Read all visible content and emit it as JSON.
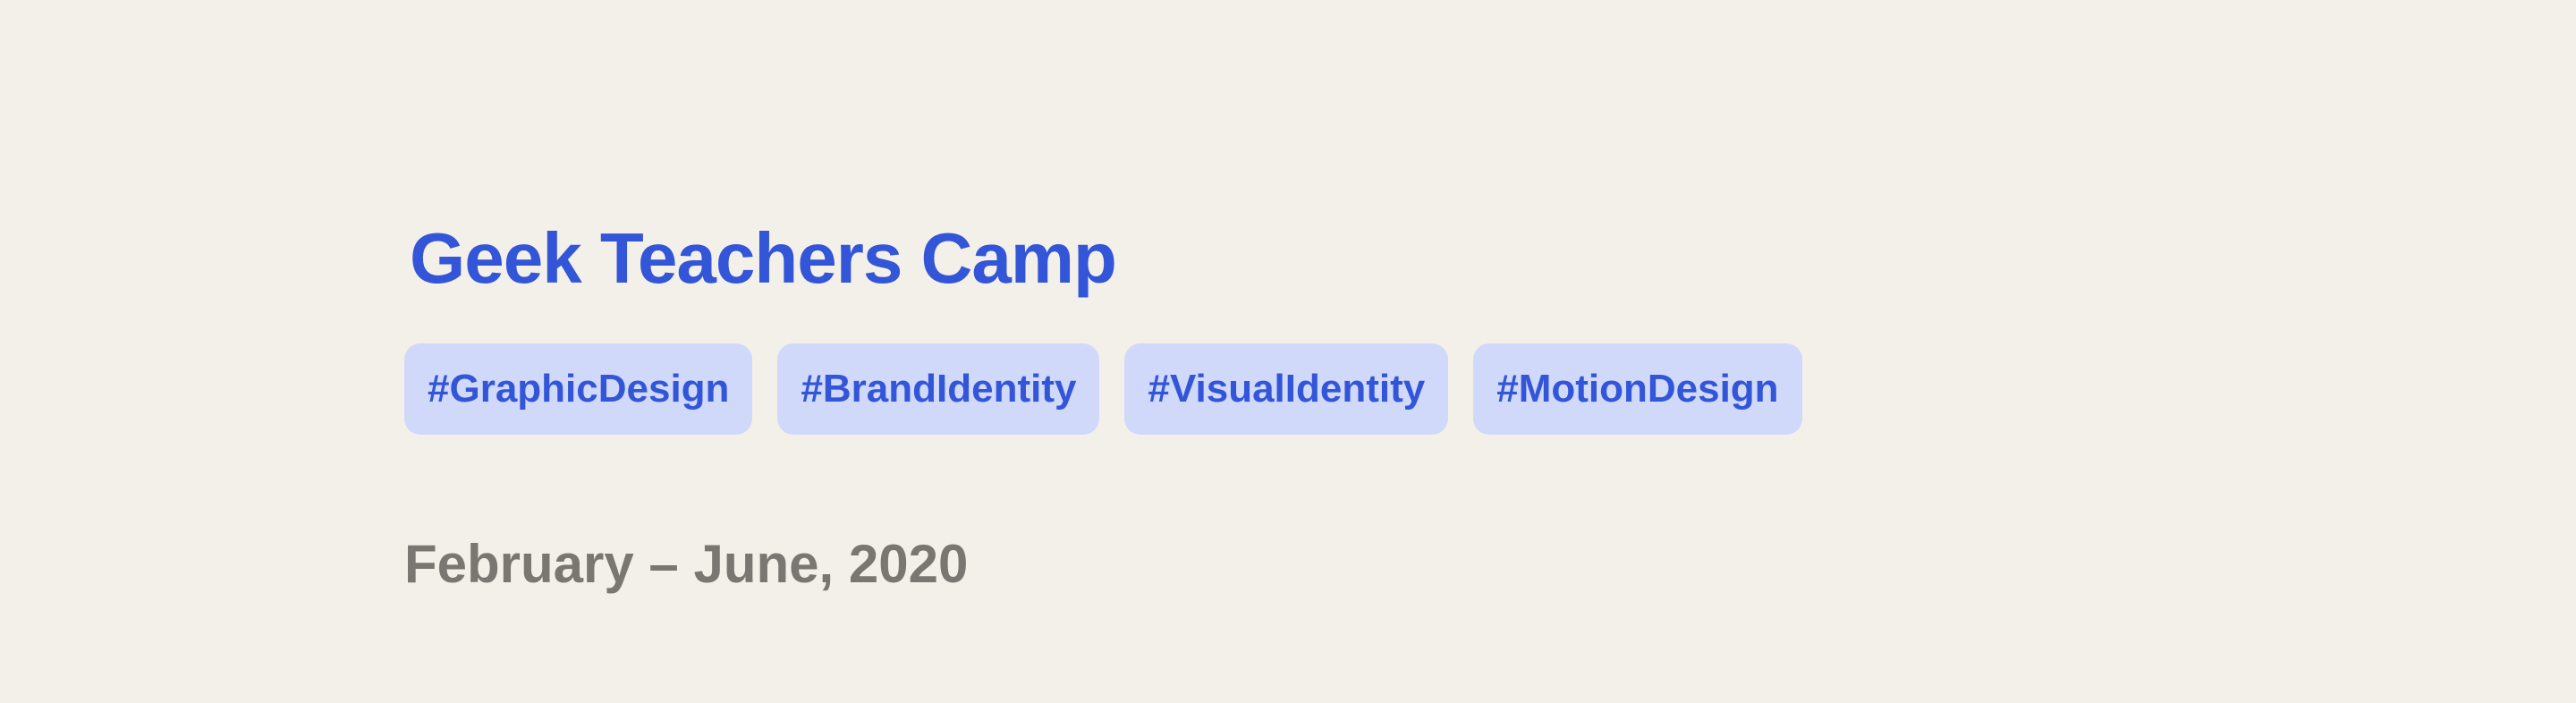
{
  "project": {
    "title": "Geek Teachers Camp",
    "tags": [
      "#GraphicDesign",
      "#BrandIdentity",
      "#VisualIdentity",
      "#MotionDesign"
    ],
    "date_range": "February – June, 2020"
  },
  "colors": {
    "background": "#F3F0EA",
    "accent": "#3355D8",
    "tag_background": "#D0D9FA",
    "muted_text": "#7A7772"
  }
}
